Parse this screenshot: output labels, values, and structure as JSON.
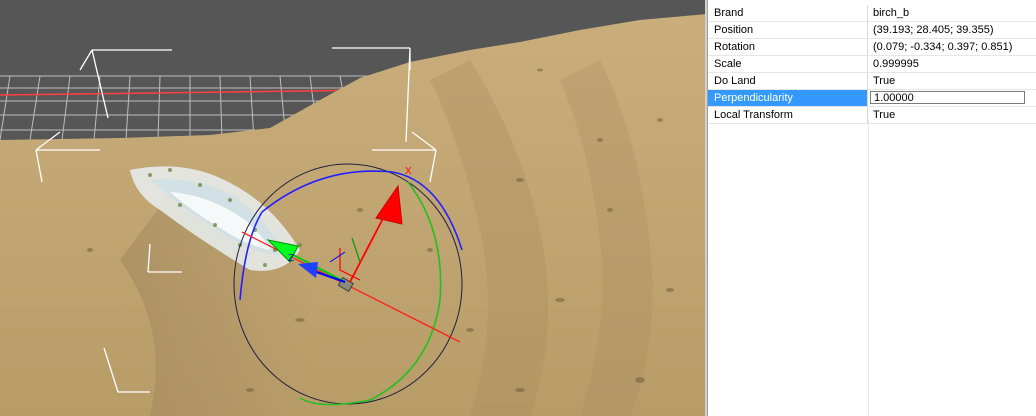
{
  "viewport": {
    "gizmo_axis_x_label": "X",
    "gizmo_axis_z_label": "Z"
  },
  "property_grid": {
    "rows": [
      {
        "name": "Brand",
        "value": "birch_b"
      },
      {
        "name": "Position",
        "value": "(39.193; 28.405; 39.355)"
      },
      {
        "name": "Rotation",
        "value": "(0.079; -0.334; 0.397; 0.851)"
      },
      {
        "name": "Scale",
        "value": "0.999995"
      },
      {
        "name": "Do Land",
        "value": "True"
      },
      {
        "name": "Perpendicularity",
        "value": "1.00000"
      },
      {
        "name": "Local Transform",
        "value": "True"
      }
    ],
    "selected_row": "Perpendicularity"
  },
  "colors": {
    "selection": "#3399ff",
    "terrain": "#c2a775",
    "axis_x": "#ff0000",
    "axis_y": "#00cc00",
    "axis_z": "#0000ff"
  }
}
